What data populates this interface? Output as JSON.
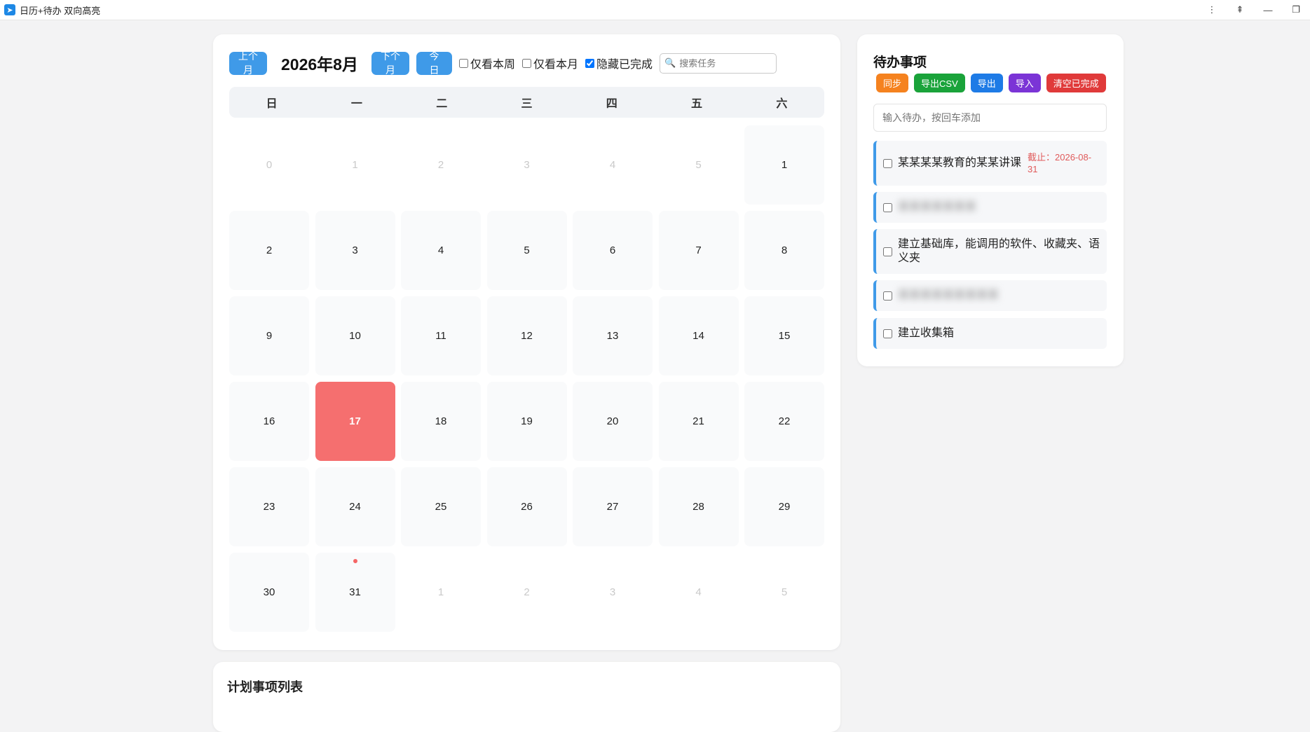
{
  "window": {
    "app_icon": "app-logo-icon",
    "title": "日历+待办 双向高亮",
    "controls": [
      "⋮",
      "⇞",
      "—",
      "❐"
    ]
  },
  "calendar": {
    "prev_label": "上个月",
    "month_title": "2026年8月",
    "next_label": "下个月",
    "today_label": "今日",
    "filters": [
      {
        "label": "仅看本周",
        "checked": false
      },
      {
        "label": "仅看本月",
        "checked": false
      },
      {
        "label": "隐藏已完成",
        "checked": true
      }
    ],
    "search": {
      "icon": "🔍",
      "placeholder": "搜索任务"
    },
    "weekdays": [
      "日",
      "一",
      "二",
      "三",
      "四",
      "五",
      "六"
    ],
    "days": [
      {
        "n": "0",
        "other": true
      },
      {
        "n": "1",
        "other": true
      },
      {
        "n": "2",
        "other": true
      },
      {
        "n": "3",
        "other": true
      },
      {
        "n": "4",
        "other": true
      },
      {
        "n": "5",
        "other": true
      },
      {
        "n": "1"
      },
      {
        "n": "2"
      },
      {
        "n": "3"
      },
      {
        "n": "4"
      },
      {
        "n": "5"
      },
      {
        "n": "6"
      },
      {
        "n": "7"
      },
      {
        "n": "8"
      },
      {
        "n": "9"
      },
      {
        "n": "10"
      },
      {
        "n": "11"
      },
      {
        "n": "12"
      },
      {
        "n": "13"
      },
      {
        "n": "14"
      },
      {
        "n": "15"
      },
      {
        "n": "16"
      },
      {
        "n": "17",
        "today": true
      },
      {
        "n": "18"
      },
      {
        "n": "19"
      },
      {
        "n": "20"
      },
      {
        "n": "21"
      },
      {
        "n": "22"
      },
      {
        "n": "23"
      },
      {
        "n": "24"
      },
      {
        "n": "25"
      },
      {
        "n": "26"
      },
      {
        "n": "27"
      },
      {
        "n": "28"
      },
      {
        "n": "29"
      },
      {
        "n": "30"
      },
      {
        "n": "31",
        "dot": true
      },
      {
        "n": "1",
        "other": true
      },
      {
        "n": "2",
        "other": true
      },
      {
        "n": "3",
        "other": true
      },
      {
        "n": "4",
        "other": true
      },
      {
        "n": "5",
        "other": true
      }
    ]
  },
  "todo": {
    "title": "待办事项",
    "actions": [
      {
        "label": "同步",
        "color": "#f5821f"
      },
      {
        "label": "导出CSV",
        "color": "#1aa33a"
      },
      {
        "label": "导出",
        "color": "#1e7be6"
      },
      {
        "label": "导入",
        "color": "#7b34d6"
      },
      {
        "label": "清空已完成",
        "color": "#e03a3a"
      }
    ],
    "input_placeholder": "输入待办，按回车添加",
    "items": [
      {
        "text": "某某某某教育的某某讲课",
        "due": "截止：2026-08-31",
        "blurred": false
      },
      {
        "text": "某某某某某某某",
        "due": "",
        "blurred": true
      },
      {
        "text": "建立基础库，能调用的软件、收藏夹、语义夹",
        "due": "",
        "blurred": false
      },
      {
        "text": "某某某某某某某某某",
        "due": "",
        "blurred": true
      },
      {
        "text": "建立收集箱",
        "due": "",
        "blurred": false
      }
    ]
  },
  "plan_list": {
    "title": "计划事项列表"
  }
}
